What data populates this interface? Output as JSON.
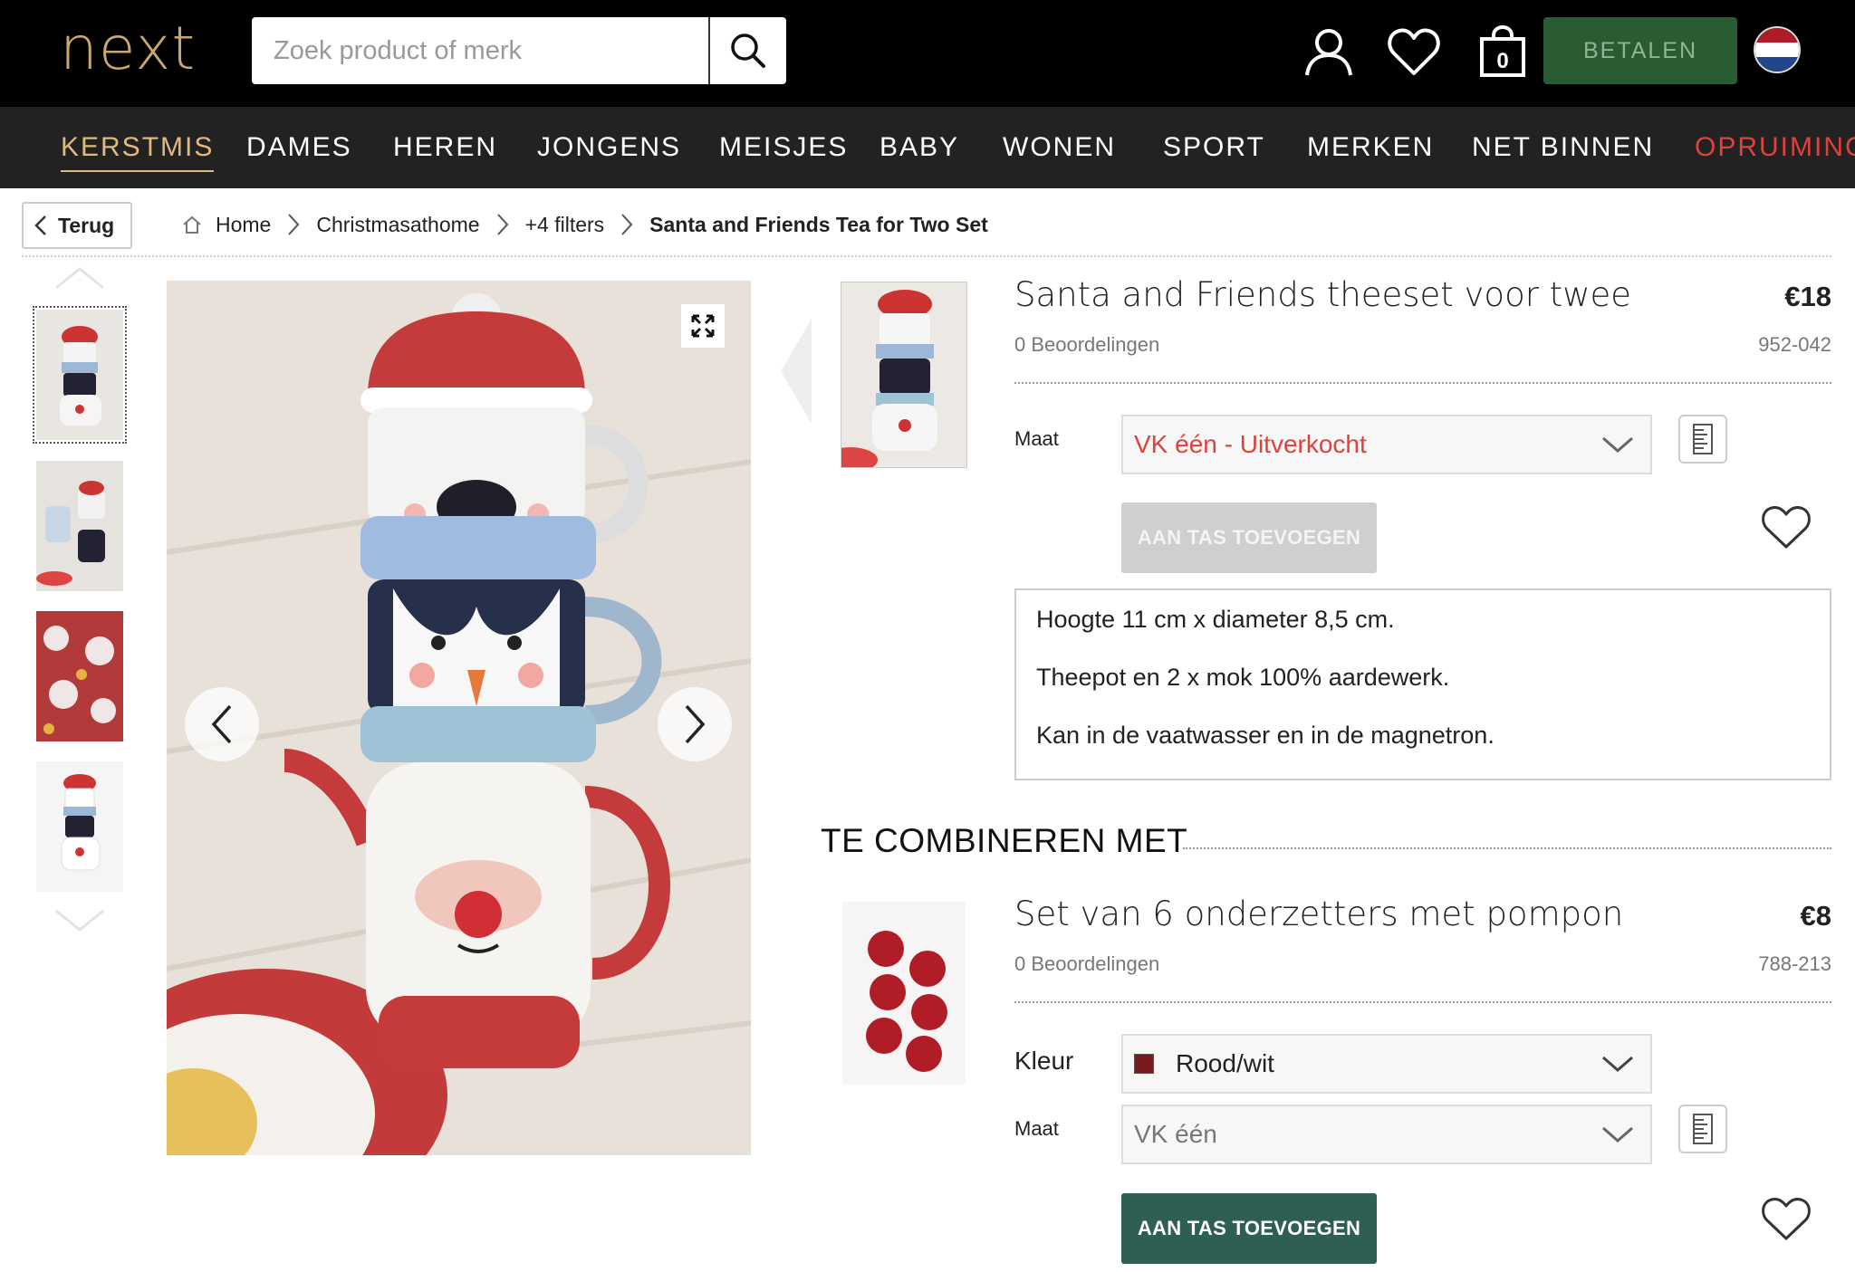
{
  "header": {
    "logo": "next",
    "search_placeholder": "Zoek product of merk",
    "bag_count": "0",
    "checkout_label": "BETALEN"
  },
  "nav": {
    "items": [
      "KERSTMIS",
      "DAMES",
      "HEREN",
      "JONGENS",
      "MEISJES",
      "BABY",
      "WONEN",
      "SPORT",
      "MERKEN",
      "NET BINNEN",
      "OPRUIMING"
    ]
  },
  "breadcrumb": {
    "back_label": "Terug",
    "items": [
      "Home",
      "Christmasathome",
      "+4 filters",
      "Santa and Friends Tea for Two Set"
    ]
  },
  "product": {
    "title": "Santa and Friends theeset voor twee",
    "price": "€18",
    "reviews": "0 Beoordelingen",
    "sku": "952-042",
    "size_label": "Maat",
    "size_value": "VK één - Uitverkocht",
    "add_label": "AAN TAS TOEVOEGEN",
    "description": [
      "Hoogte 11 cm x diameter 8,5 cm.",
      "Theepot en 2 x mok 100% aardewerk.",
      "Kan in de vaatwasser en in de magnetron."
    ]
  },
  "combine": {
    "title": "TE COMBINEREN MET",
    "item": {
      "title": "Set van 6 onderzetters met pompon",
      "price": "€8",
      "reviews": "0 Beoordelingen",
      "sku": "788-213",
      "color_label": "Kleur",
      "color_value": "Rood/wit",
      "size_label": "Maat",
      "size_value": "VK één",
      "add_label": "AAN TAS TOEVOEGEN"
    }
  },
  "colors": {
    "header_bg": "#000000",
    "nav_bg": "#222222",
    "logo_gold": "#c9a96b",
    "active_nav": "#e3b97b",
    "sale_red": "#e0413a",
    "checkout_green": "#2a5c33",
    "add_button_teal": "#2f5e53",
    "sold_out_red": "#e0413a"
  }
}
